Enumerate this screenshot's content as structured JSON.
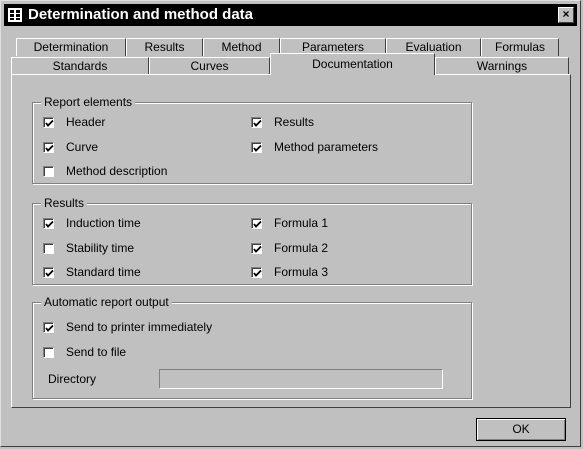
{
  "window": {
    "title": "Determination and method data",
    "close_label": "×"
  },
  "tabs_row1": [
    "Determination",
    "Results",
    "Method",
    "Parameters",
    "Evaluation",
    "Formulas"
  ],
  "tabs_row2": [
    "Standards",
    "Curves",
    "Documentation",
    "Warnings"
  ],
  "active_tab": "Documentation",
  "report_elements": {
    "title": "Report elements",
    "header": {
      "label": "Header",
      "checked": true
    },
    "curve": {
      "label": "Curve",
      "checked": true
    },
    "method_description": {
      "label": "Method description",
      "checked": false
    },
    "results": {
      "label": "Results",
      "checked": true
    },
    "method_parameters": {
      "label": "Method parameters",
      "checked": true
    }
  },
  "results_group": {
    "title": "Results",
    "induction_time": {
      "label": "Induction time",
      "checked": true
    },
    "stability_time": {
      "label": "Stability time",
      "checked": false
    },
    "standard_time": {
      "label": "Standard time",
      "checked": true
    },
    "formula1": {
      "label": "Formula 1",
      "checked": true
    },
    "formula2": {
      "label": "Formula 2",
      "checked": true
    },
    "formula3": {
      "label": "Formula 3",
      "checked": true
    }
  },
  "auto_output": {
    "title": "Automatic report output",
    "send_printer": {
      "label": "Send to printer immediately",
      "checked": true
    },
    "send_file": {
      "label": "Send to file",
      "checked": false
    },
    "directory_label": "Directory",
    "directory_value": ""
  },
  "buttons": {
    "ok": "OK"
  }
}
